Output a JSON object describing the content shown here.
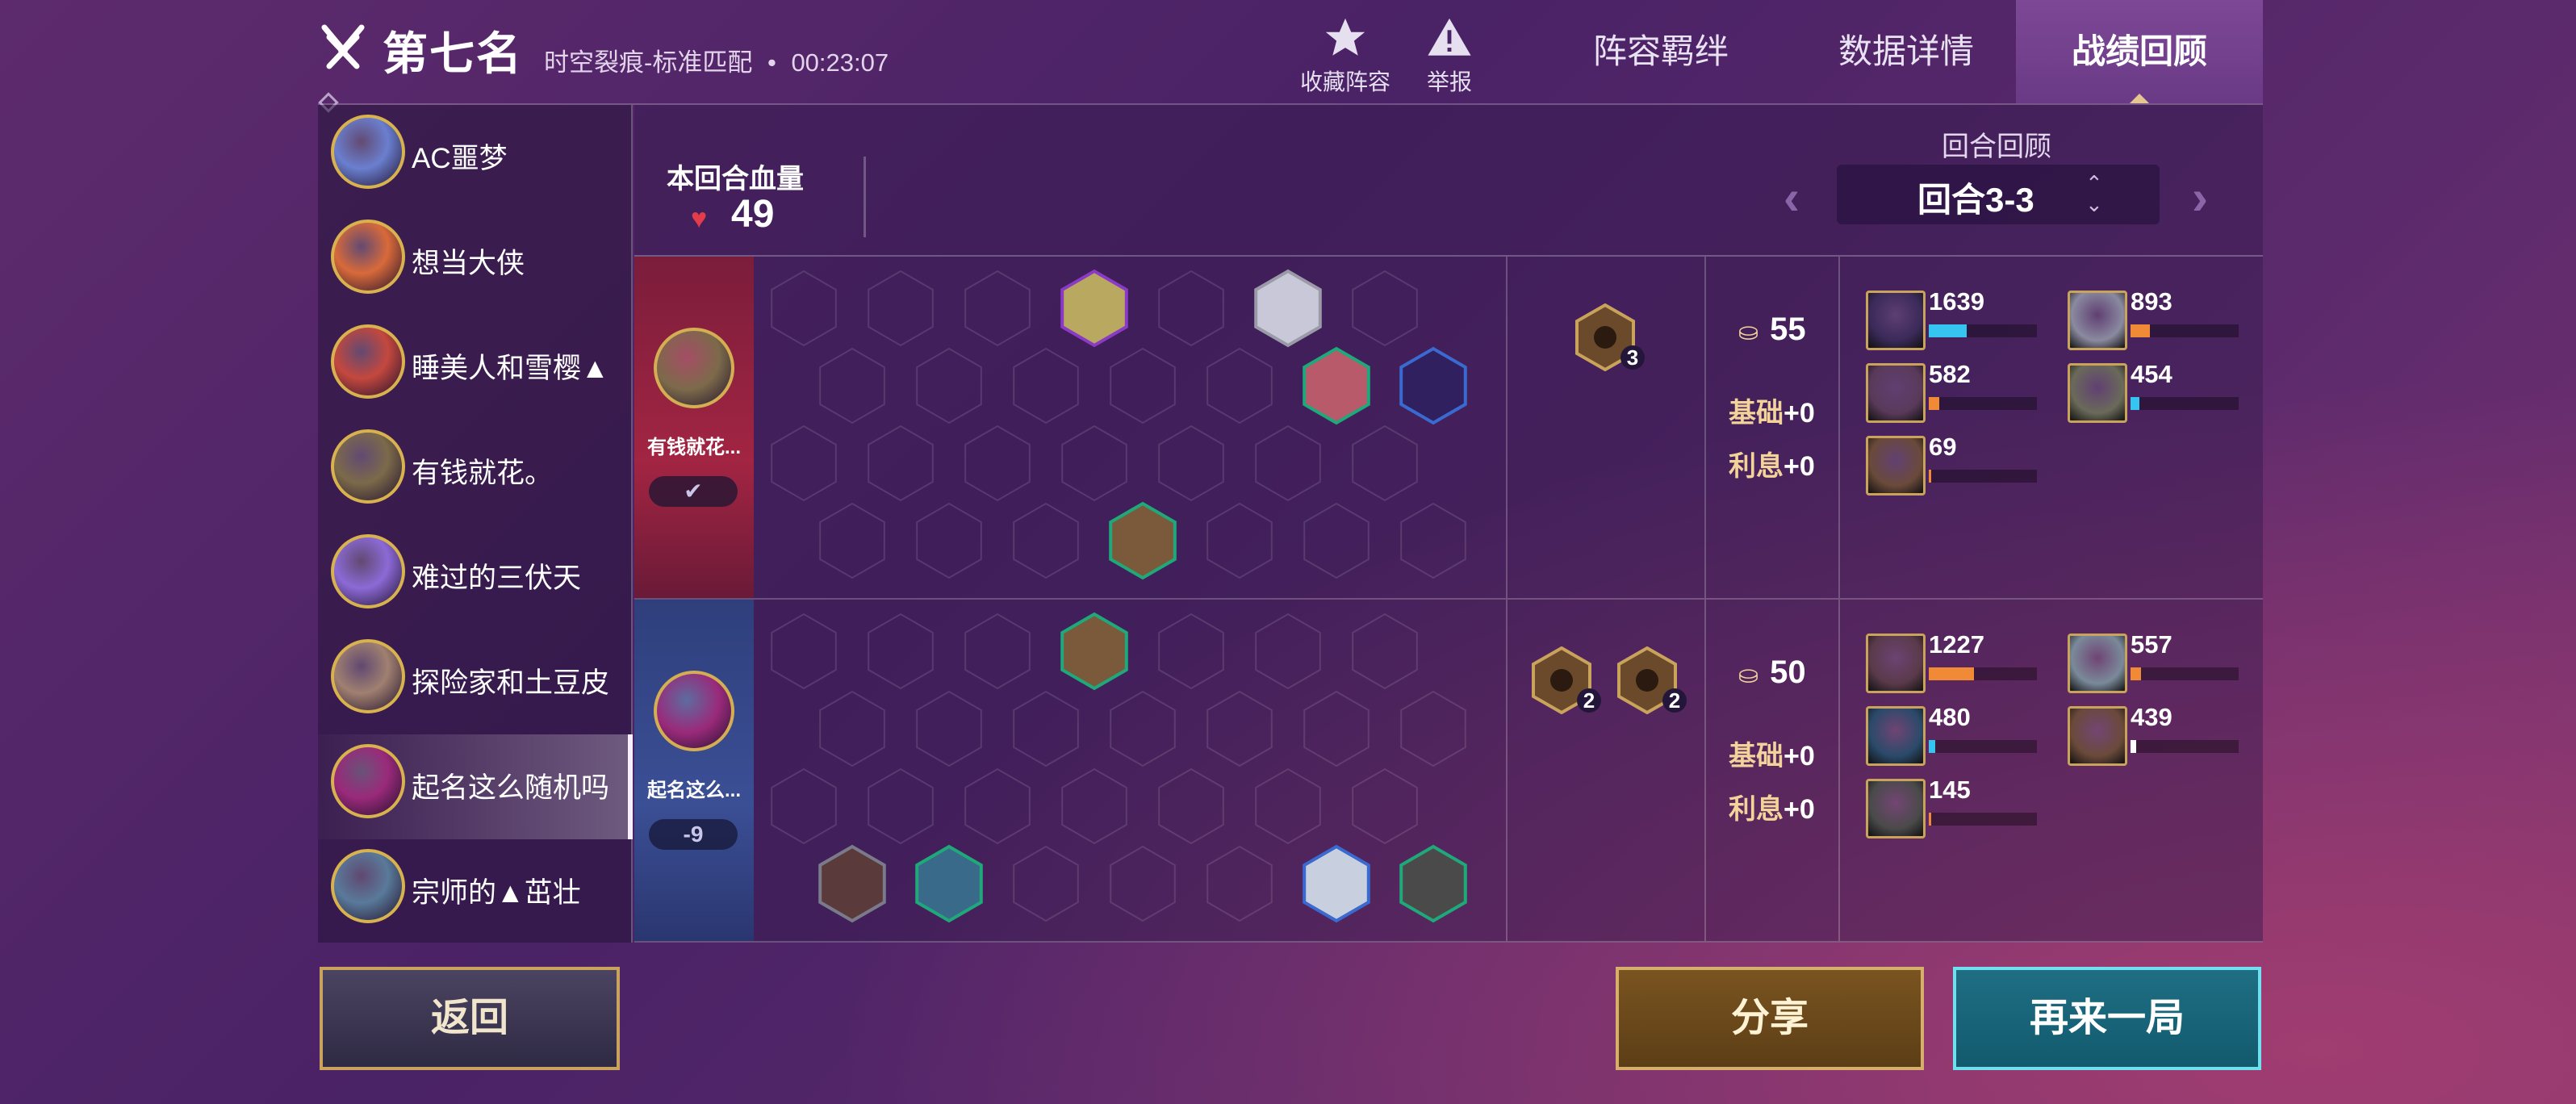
{
  "header": {
    "title": "第七名",
    "mode": "时空裂痕-标准匹配",
    "duration": "00:23:07",
    "actions": [
      {
        "label": "收藏阵容",
        "icon": "star-icon"
      },
      {
        "label": "举报",
        "icon": "warning-icon"
      }
    ],
    "tabs": [
      {
        "label": "阵容羁绊",
        "active": false
      },
      {
        "label": "数据详情",
        "active": false
      },
      {
        "label": "战绩回顾",
        "active": true
      }
    ]
  },
  "players": [
    {
      "name": "AC噩梦",
      "color": "#6a7fcf"
    },
    {
      "name": "想当大侠",
      "color": "#d86a3a"
    },
    {
      "name": "睡美人和雪樱▲",
      "color": "#c4483e"
    },
    {
      "name": "有钱就花。",
      "color": "#7c6a4a"
    },
    {
      "name": "难过的三伏天",
      "color": "#8c6ad6"
    },
    {
      "name": "探险家和土豆皮",
      "color": "#a08070"
    },
    {
      "name": "起名这么随机吗",
      "color": "#9a2a7a",
      "selected": true
    },
    {
      "name": "宗师的▲茁壮",
      "color": "#5a7a9a"
    }
  ],
  "round": {
    "hp_label": "本回合血量",
    "hp": "49",
    "review_label": "回合回顾",
    "current": "回合3-3"
  },
  "rows": [
    {
      "side": "red",
      "player": "有钱就花...",
      "badge": "✔",
      "gold": "55",
      "base_label": "基础",
      "base": "+0",
      "interest_label": "利息",
      "interest": "+0",
      "traits": [
        {
          "count": "3",
          "icon": "mask-icon"
        }
      ],
      "units": [
        {
          "hp": "1639",
          "fill": 0.35,
          "bar": "#36c4f0",
          "color": "#3a2a5a",
          "stars": 1
        },
        {
          "hp": "893",
          "fill": 0.18,
          "bar": "#f08a36",
          "color": "#8a8aa0",
          "stars": 2
        },
        {
          "hp": "582",
          "fill": 0.1,
          "bar": "#f08a36",
          "color": "#5a3a5a",
          "stars": 2
        },
        {
          "hp": "454",
          "fill": 0.08,
          "bar": "#36c4f0",
          "color": "#6a6a5a",
          "stars": 1
        },
        {
          "hp": "69",
          "fill": 0.02,
          "bar": "#f08a36",
          "color": "#6a4a3a",
          "stars": 1
        }
      ]
    },
    {
      "side": "blue",
      "player": "起名这么...",
      "badge": "-9",
      "gold": "50",
      "base_label": "基础",
      "base": "+0",
      "interest_label": "利息",
      "interest": "+0",
      "traits": [
        {
          "count": "2",
          "icon": "bow-icon"
        },
        {
          "count": "2",
          "icon": "snowflake-icon"
        }
      ],
      "units": [
        {
          "hp": "1227",
          "fill": 0.42,
          "bar": "#f08a36",
          "color": "#5a3a4a",
          "stars": 2
        },
        {
          "hp": "557",
          "fill": 0.1,
          "bar": "#f08a36",
          "color": "#7a8a9a",
          "stars": 1
        },
        {
          "hp": "480",
          "fill": 0.06,
          "bar": "#36c4f0",
          "color": "#2a4a6a",
          "stars": 1
        },
        {
          "hp": "439",
          "fill": 0.05,
          "bar": "#ffffff",
          "color": "#6a4a3a",
          "stars": 1
        },
        {
          "hp": "145",
          "fill": 0.02,
          "bar": "#f08a36",
          "color": "#4a4a4a",
          "stars": 1
        }
      ]
    }
  ],
  "buttons": {
    "back": "返回",
    "share": "分享",
    "again": "再来一局"
  }
}
